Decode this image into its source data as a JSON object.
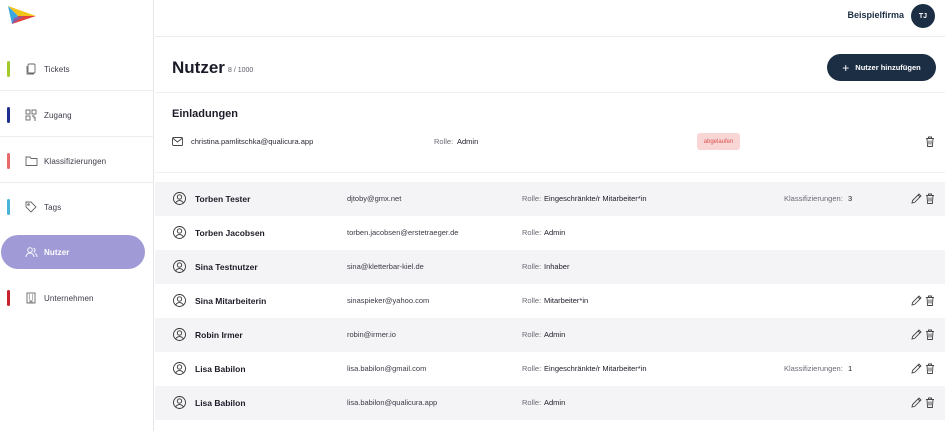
{
  "brand": {
    "company": "Beispielfirma",
    "user_initials": "TJ",
    "accent": "#1c2e44"
  },
  "sidebar": {
    "items": [
      {
        "label": "Tickets",
        "icon": "tickets-icon",
        "color": "#a4c92a"
      },
      {
        "label": "Zugang",
        "icon": "qr-code-icon",
        "color": "#1f2f8f"
      },
      {
        "label": "Klassifizierungen",
        "icon": "folder-icon",
        "color": "#e86a6a"
      },
      {
        "label": "Tags",
        "icon": "tag-icon",
        "color": "#4ab3d8"
      },
      {
        "label": "Nutzer",
        "icon": "users-icon",
        "color": "#a09bd6",
        "active": true
      },
      {
        "label": "Unternehmen",
        "icon": "building-icon",
        "color": "#c8232c"
      }
    ]
  },
  "main": {
    "title": "Nutzer",
    "count": "8 / 1000",
    "add_button": "Nutzer hinzufügen"
  },
  "invitations": {
    "title": "Einladungen",
    "items": [
      {
        "email": "christina.pamlitschka@qualicura.app",
        "role_label": "Rolle:",
        "role": "Admin",
        "status": "abgelaufen"
      }
    ]
  },
  "users": {
    "role_label": "Rolle:",
    "class_label": "Klassifizierungen:",
    "rows": [
      {
        "name": "Torben Tester",
        "email": "djtoby@gmx.net",
        "role": "Eingeschränkte/r Mitarbeiter*in",
        "classifications": "3",
        "editable": true
      },
      {
        "name": "Torben Jacobsen",
        "email": "torben.jacobsen@erstetraeger.de",
        "role": "Admin",
        "classifications": "",
        "editable": false
      },
      {
        "name": "Sina Testnutzer",
        "email": "sina@kletterbar-kiel.de",
        "role": "Inhaber",
        "classifications": "",
        "editable": false
      },
      {
        "name": "Sina Mitarbeiterin",
        "email": "sinaspieker@yahoo.com",
        "role": "Mitarbeiter*in",
        "classifications": "",
        "editable": true
      },
      {
        "name": "Robin Irmer",
        "email": "robin@irmer.io",
        "role": "Admin",
        "classifications": "",
        "editable": true
      },
      {
        "name": "Lisa Babilon",
        "email": "lisa.babilon@gmail.com",
        "role": "Eingeschränkte/r Mitarbeiter*in",
        "classifications": "1",
        "editable": true
      },
      {
        "name": "Lisa Babilon",
        "email": "lisa.babilon@qualicura.app",
        "role": "Admin",
        "classifications": "",
        "editable": true
      }
    ]
  }
}
